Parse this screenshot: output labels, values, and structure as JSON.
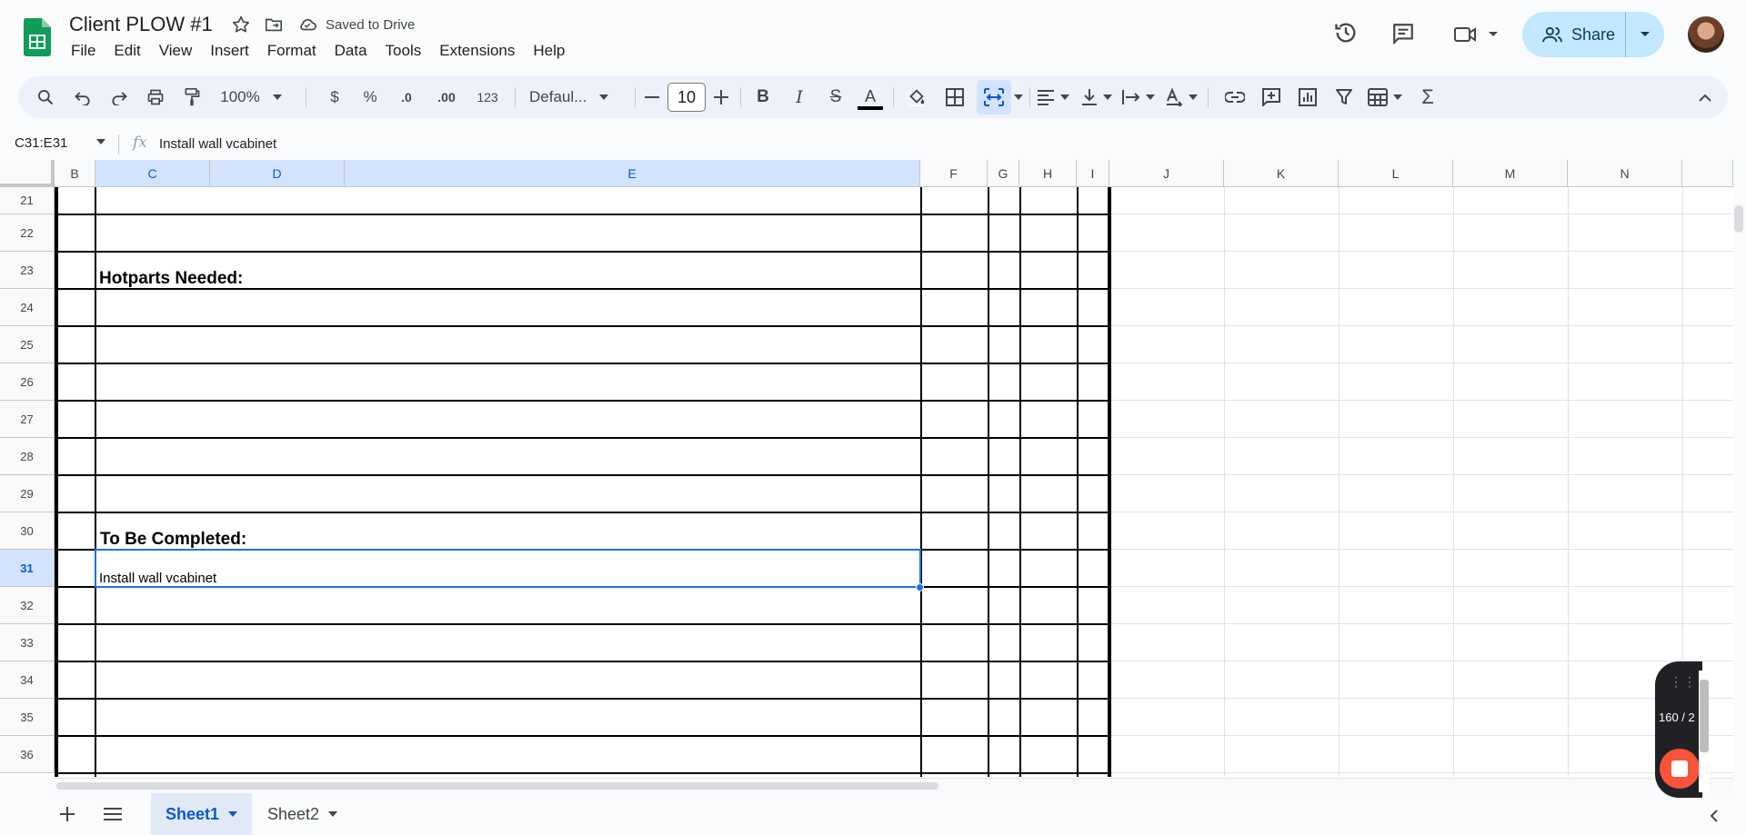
{
  "document": {
    "title": "Client PLOW #1",
    "save_status": "Saved to Drive"
  },
  "menu": [
    "File",
    "Edit",
    "View",
    "Insert",
    "Format",
    "Data",
    "Tools",
    "Extensions",
    "Help"
  ],
  "share": {
    "label": "Share"
  },
  "toolbar": {
    "zoom": "100%",
    "currency": "$",
    "percent": "%",
    "decrease_decimal": ".0",
    "increase_decimal": ".00",
    "number_format": "123",
    "font": "Defaul...",
    "font_size": "10",
    "bold": "B",
    "italic": "I",
    "strikethrough": "S",
    "text_color": "A",
    "sum": "Σ"
  },
  "formula_bar": {
    "name_box": "C31:E31",
    "fx": "fx",
    "value": "Install wall vcabinet"
  },
  "grid": {
    "columns": [
      "B",
      "C",
      "D",
      "E",
      "F",
      "G",
      "H",
      "I",
      "J",
      "K",
      "L",
      "M",
      "N"
    ],
    "rows": [
      "21",
      "22",
      "23",
      "24",
      "25",
      "26",
      "27",
      "28",
      "29",
      "30",
      "31",
      "32",
      "33",
      "34",
      "35",
      "36"
    ],
    "cells": {
      "hotparts_header": "Hotparts Needed:",
      "to_be_completed_header": "To Be Completed:",
      "row31_value": "Install wall vcabinet"
    }
  },
  "sheets": [
    {
      "name": "Sheet1",
      "active": true
    },
    {
      "name": "Sheet2",
      "active": false
    }
  ],
  "recorder": {
    "count": "160 / 2"
  },
  "colors": {
    "accent": "#1a73e8",
    "share_bg": "#c2e7ff",
    "selected_header": "#d3e3fd",
    "record": "#f9533b"
  }
}
